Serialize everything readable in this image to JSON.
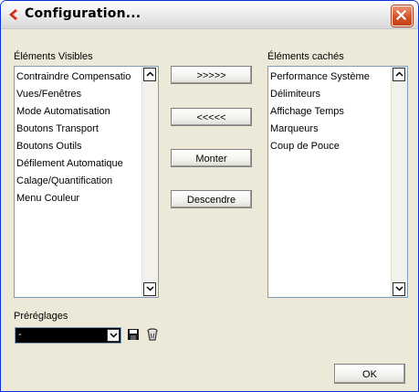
{
  "window": {
    "title": "Configuration...",
    "close_icon": "close-icon"
  },
  "visible_list": {
    "label": "Éléments Visibles",
    "items": [
      "Contraindre Compensatio",
      "Vues/Fenêtres",
      "Mode Automatisation",
      "Boutons Transport",
      "Boutons Outils",
      "Défilement Automatique",
      "Calage/Quantification",
      "Menu Couleur"
    ]
  },
  "hidden_list": {
    "label": "Éléments cachés",
    "items": [
      "Performance Système",
      "Délimiteurs",
      "Affichage Temps",
      "Marqueurs",
      "Coup de Pouce"
    ]
  },
  "buttons": {
    "move_right": ">>>>>",
    "move_left": "<<<<<",
    "move_up": "Monter",
    "move_down": "Descendre",
    "ok": "OK"
  },
  "presets": {
    "label": "Préréglages",
    "value": "-",
    "save_icon": "save-icon",
    "delete_icon": "trash-icon"
  }
}
